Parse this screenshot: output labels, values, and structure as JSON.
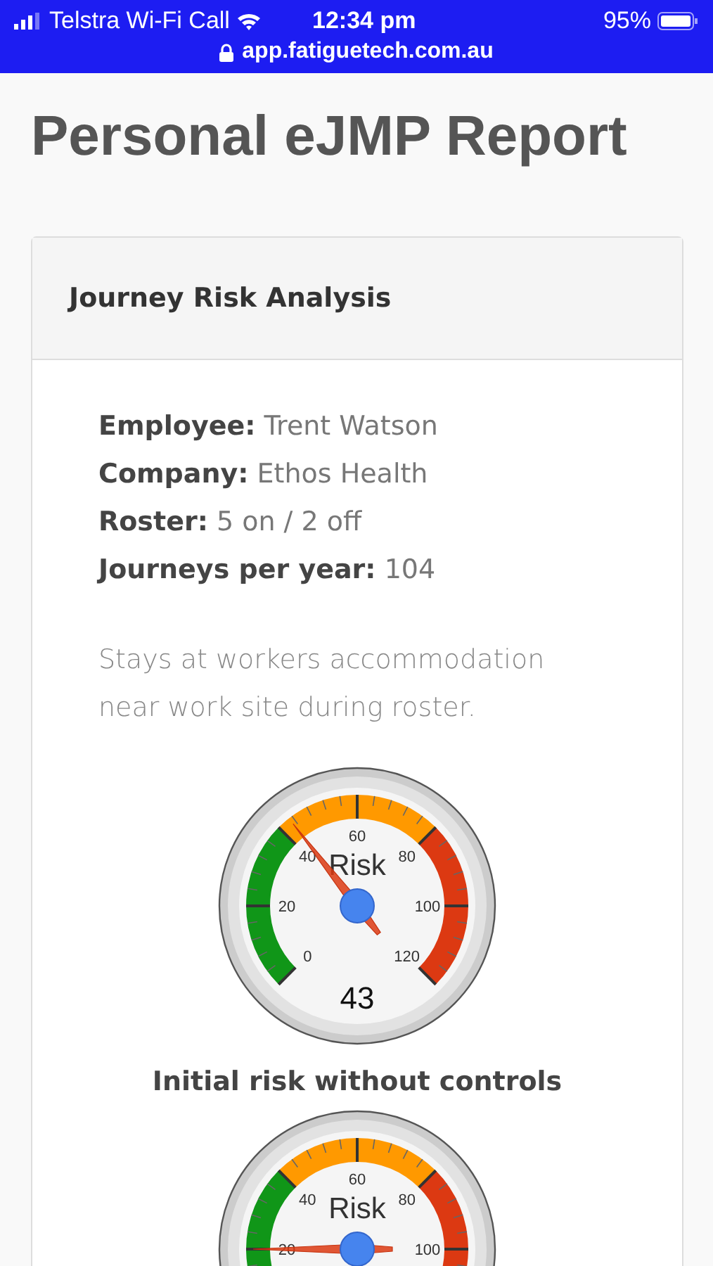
{
  "status_bar": {
    "carrier": "Telstra Wi-Fi Call",
    "time": "12:34 pm",
    "battery": "95%",
    "address": "app.fatiguetech.com.au"
  },
  "page_title": "Personal eJMP Report",
  "card": {
    "title": "Journey Risk Analysis",
    "details": [
      {
        "label": "Employee:",
        "value": "Trent Watson"
      },
      {
        "label": "Company:",
        "value": "Ethos Health"
      },
      {
        "label": "Roster:",
        "value": "5 on / 2 off"
      },
      {
        "label": "Journeys per year:",
        "value": "104"
      }
    ],
    "note": "Stays at workers accommodation near work site during roster.",
    "gauges": [
      {
        "label": "Risk",
        "reading": "43",
        "scale_labels": [
          "0",
          "20",
          "40",
          "60",
          "80",
          "100",
          "120"
        ],
        "caption": "Initial risk without controls"
      },
      {
        "label": "Risk",
        "scale_labels": [
          "20",
          "40",
          "60",
          "80",
          "100"
        ]
      }
    ]
  }
}
